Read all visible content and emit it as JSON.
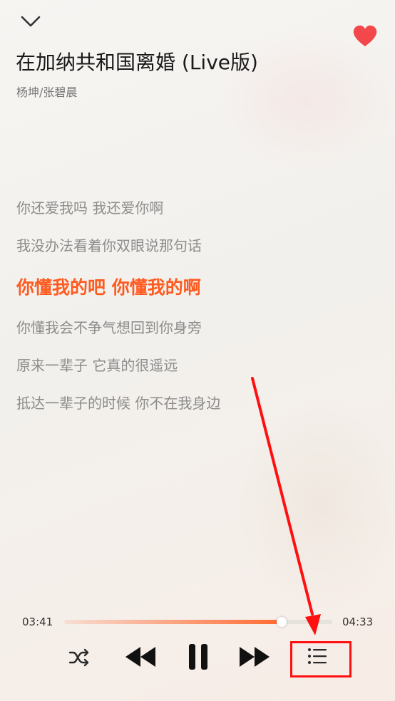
{
  "header": {
    "collapse_icon": "chevron-down-icon",
    "like_icon": "heart-icon",
    "like_color": "#f2474b"
  },
  "song": {
    "title": "在加纳共和国离婚 (Live版)",
    "artist": "杨坤/张碧晨"
  },
  "lyrics": [
    {
      "text": "你还爱我吗 我还爱你啊",
      "active": false
    },
    {
      "text": "我没办法看着你双眼说那句话",
      "active": false
    },
    {
      "text": "你懂我的吧 你懂我的啊",
      "active": true
    },
    {
      "text": "你懂我会不争气想回到你身旁",
      "active": false
    },
    {
      "text": "原来一辈子 它真的很遥远",
      "active": false
    },
    {
      "text": "抵达一辈子的时候 你不在我身边",
      "active": false
    }
  ],
  "playback": {
    "current_time": "03:41",
    "total_time": "04:33",
    "progress": 0.81,
    "accent_color": "#ff5a1f"
  },
  "controls": {
    "shuffle_icon": "shuffle-icon",
    "prev_icon": "previous-icon",
    "pause_icon": "pause-icon",
    "next_icon": "next-icon",
    "playlist_icon": "playlist-icon"
  },
  "annotation": {
    "color": "#ff1010"
  }
}
